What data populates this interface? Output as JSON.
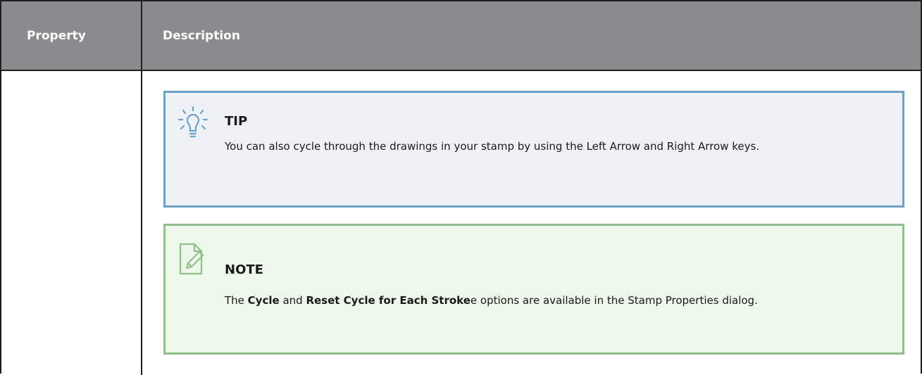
{
  "table": {
    "headers": {
      "property": "Property",
      "description": "Description"
    }
  },
  "tip": {
    "title": "TIP",
    "icon": "lightbulb-icon",
    "border_color": "#6ba3c8",
    "background": "#eef2f7",
    "text": "You can also cycle through the drawings in your stamp by using the Left Arrow and Right Arrow keys."
  },
  "note": {
    "title": "NOTE",
    "icon": "note-pencil-icon",
    "border_color": "#8fbf8a",
    "background": "#eef8ea",
    "text_prefix": "The ",
    "bold_1": "Cycle",
    "text_mid": " and ",
    "bold_2": "Reset Cycle for Each Stroke",
    "text_suffix": "e options are available in the Stamp Properties dialog."
  }
}
